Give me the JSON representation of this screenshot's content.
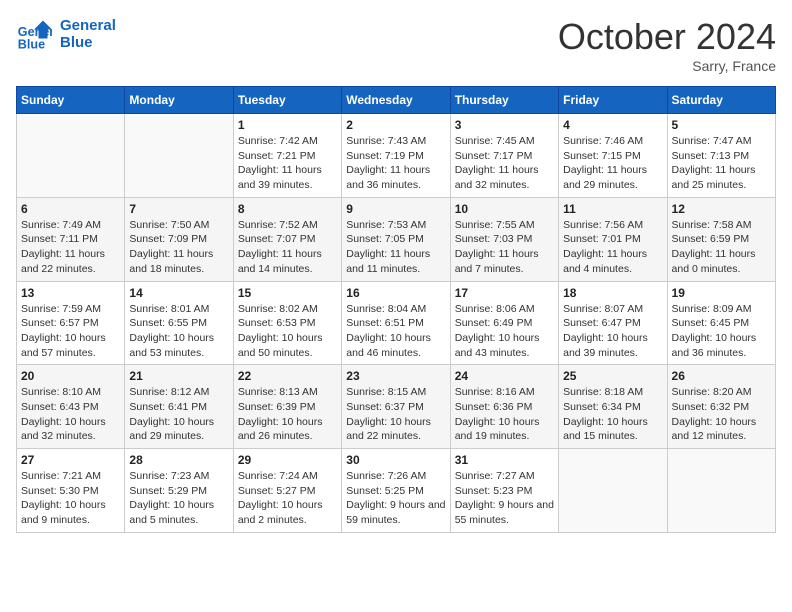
{
  "logo": {
    "line1": "General",
    "line2": "Blue"
  },
  "title": "October 2024",
  "subtitle": "Sarry, France",
  "days_header": [
    "Sunday",
    "Monday",
    "Tuesday",
    "Wednesday",
    "Thursday",
    "Friday",
    "Saturday"
  ],
  "weeks": [
    [
      {
        "day": "",
        "info": ""
      },
      {
        "day": "",
        "info": ""
      },
      {
        "day": "1",
        "info": "Sunrise: 7:42 AM\nSunset: 7:21 PM\nDaylight: 11 hours and 39 minutes."
      },
      {
        "day": "2",
        "info": "Sunrise: 7:43 AM\nSunset: 7:19 PM\nDaylight: 11 hours and 36 minutes."
      },
      {
        "day": "3",
        "info": "Sunrise: 7:45 AM\nSunset: 7:17 PM\nDaylight: 11 hours and 32 minutes."
      },
      {
        "day": "4",
        "info": "Sunrise: 7:46 AM\nSunset: 7:15 PM\nDaylight: 11 hours and 29 minutes."
      },
      {
        "day": "5",
        "info": "Sunrise: 7:47 AM\nSunset: 7:13 PM\nDaylight: 11 hours and 25 minutes."
      }
    ],
    [
      {
        "day": "6",
        "info": "Sunrise: 7:49 AM\nSunset: 7:11 PM\nDaylight: 11 hours and 22 minutes."
      },
      {
        "day": "7",
        "info": "Sunrise: 7:50 AM\nSunset: 7:09 PM\nDaylight: 11 hours and 18 minutes."
      },
      {
        "day": "8",
        "info": "Sunrise: 7:52 AM\nSunset: 7:07 PM\nDaylight: 11 hours and 14 minutes."
      },
      {
        "day": "9",
        "info": "Sunrise: 7:53 AM\nSunset: 7:05 PM\nDaylight: 11 hours and 11 minutes."
      },
      {
        "day": "10",
        "info": "Sunrise: 7:55 AM\nSunset: 7:03 PM\nDaylight: 11 hours and 7 minutes."
      },
      {
        "day": "11",
        "info": "Sunrise: 7:56 AM\nSunset: 7:01 PM\nDaylight: 11 hours and 4 minutes."
      },
      {
        "day": "12",
        "info": "Sunrise: 7:58 AM\nSunset: 6:59 PM\nDaylight: 11 hours and 0 minutes."
      }
    ],
    [
      {
        "day": "13",
        "info": "Sunrise: 7:59 AM\nSunset: 6:57 PM\nDaylight: 10 hours and 57 minutes."
      },
      {
        "day": "14",
        "info": "Sunrise: 8:01 AM\nSunset: 6:55 PM\nDaylight: 10 hours and 53 minutes."
      },
      {
        "day": "15",
        "info": "Sunrise: 8:02 AM\nSunset: 6:53 PM\nDaylight: 10 hours and 50 minutes."
      },
      {
        "day": "16",
        "info": "Sunrise: 8:04 AM\nSunset: 6:51 PM\nDaylight: 10 hours and 46 minutes."
      },
      {
        "day": "17",
        "info": "Sunrise: 8:06 AM\nSunset: 6:49 PM\nDaylight: 10 hours and 43 minutes."
      },
      {
        "day": "18",
        "info": "Sunrise: 8:07 AM\nSunset: 6:47 PM\nDaylight: 10 hours and 39 minutes."
      },
      {
        "day": "19",
        "info": "Sunrise: 8:09 AM\nSunset: 6:45 PM\nDaylight: 10 hours and 36 minutes."
      }
    ],
    [
      {
        "day": "20",
        "info": "Sunrise: 8:10 AM\nSunset: 6:43 PM\nDaylight: 10 hours and 32 minutes."
      },
      {
        "day": "21",
        "info": "Sunrise: 8:12 AM\nSunset: 6:41 PM\nDaylight: 10 hours and 29 minutes."
      },
      {
        "day": "22",
        "info": "Sunrise: 8:13 AM\nSunset: 6:39 PM\nDaylight: 10 hours and 26 minutes."
      },
      {
        "day": "23",
        "info": "Sunrise: 8:15 AM\nSunset: 6:37 PM\nDaylight: 10 hours and 22 minutes."
      },
      {
        "day": "24",
        "info": "Sunrise: 8:16 AM\nSunset: 6:36 PM\nDaylight: 10 hours and 19 minutes."
      },
      {
        "day": "25",
        "info": "Sunrise: 8:18 AM\nSunset: 6:34 PM\nDaylight: 10 hours and 15 minutes."
      },
      {
        "day": "26",
        "info": "Sunrise: 8:20 AM\nSunset: 6:32 PM\nDaylight: 10 hours and 12 minutes."
      }
    ],
    [
      {
        "day": "27",
        "info": "Sunrise: 7:21 AM\nSunset: 5:30 PM\nDaylight: 10 hours and 9 minutes."
      },
      {
        "day": "28",
        "info": "Sunrise: 7:23 AM\nSunset: 5:29 PM\nDaylight: 10 hours and 5 minutes."
      },
      {
        "day": "29",
        "info": "Sunrise: 7:24 AM\nSunset: 5:27 PM\nDaylight: 10 hours and 2 minutes."
      },
      {
        "day": "30",
        "info": "Sunrise: 7:26 AM\nSunset: 5:25 PM\nDaylight: 9 hours and 59 minutes."
      },
      {
        "day": "31",
        "info": "Sunrise: 7:27 AM\nSunset: 5:23 PM\nDaylight: 9 hours and 55 minutes."
      },
      {
        "day": "",
        "info": ""
      },
      {
        "day": "",
        "info": ""
      }
    ]
  ]
}
